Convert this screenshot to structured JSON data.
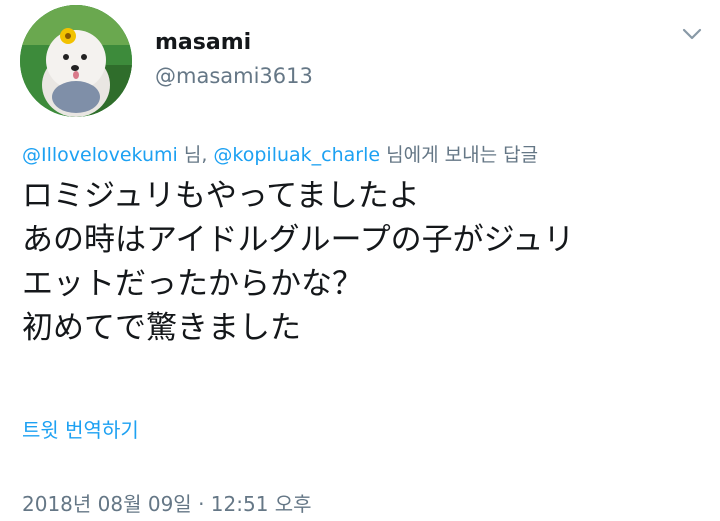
{
  "user": {
    "display_name": "masami",
    "handle": "@masami3613"
  },
  "reply": {
    "mention_1": "@Illovelovekumi",
    "separator": " 님, ",
    "mention_2": "@kopiluak_charle",
    "suffix": " 님에게 보내는 답글"
  },
  "tweet": {
    "lines": [
      "ロミジュリもやってましたよ",
      "あの時はアイドルグループの子がジュリ",
      "エットだったからかな？",
      "初めてで驚きました"
    ]
  },
  "translate_label": "트윗 번역하기",
  "timestamp": "2018년 08월 09일 · 12:51 오후",
  "icons": {
    "menu": "chevron-down-icon",
    "avatar": "avatar"
  },
  "colors": {
    "link": "#1da1f2",
    "secondary_text": "#657786",
    "primary_text": "#14171a"
  }
}
